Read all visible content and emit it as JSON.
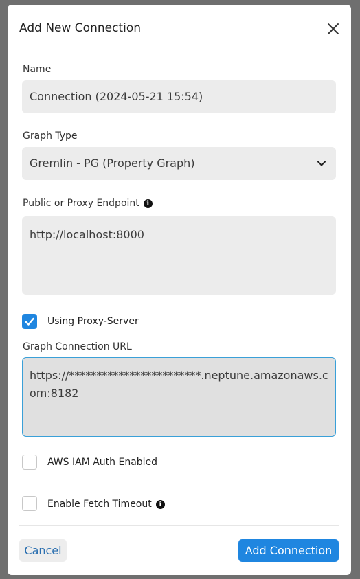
{
  "dialog": {
    "title": "Add New Connection",
    "close_icon": "close-icon"
  },
  "form": {
    "name_label": "Name",
    "name_value": "Connection (2024-05-21 15:54)",
    "graph_type_label": "Graph Type",
    "graph_type_value": "Gremlin - PG (Property Graph)",
    "endpoint_label": "Public or Proxy Endpoint",
    "endpoint_value": "http://localhost:8000",
    "proxy_label": "Using Proxy-Server",
    "proxy_checked": true,
    "graph_url_label": "Graph Connection URL",
    "graph_url_value": "https://************************.neptune.amazonaws.com:8182",
    "iam_label": "AWS IAM Auth Enabled",
    "iam_checked": false,
    "timeout_label": "Enable Fetch Timeout",
    "timeout_checked": false
  },
  "footer": {
    "cancel_label": "Cancel",
    "add_label": "Add Connection"
  },
  "colors": {
    "accent": "#1f86e0",
    "field_bg": "#ececec",
    "focus_border": "#3aa0d8"
  }
}
